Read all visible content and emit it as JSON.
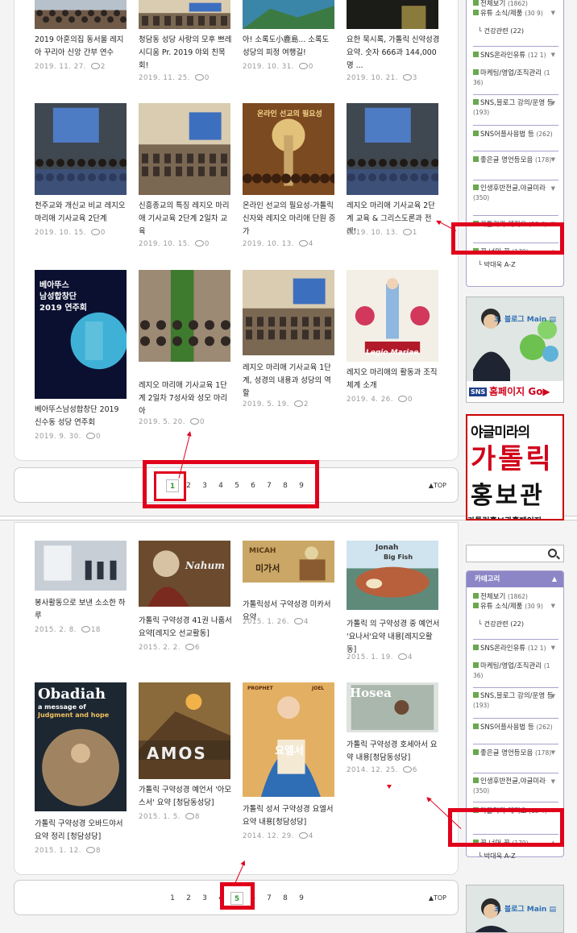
{
  "top": {
    "posts": [
      {
        "title": "2019 아훈의집 동서울 레지아 꾸리아 신앙 간부 연수",
        "date": "2019. 11. 27.",
        "comments": "2"
      },
      {
        "title": "청담동 성당 사랑의 모후 쁘레시디움 Pr. 2019 야외 친목회!",
        "date": "2019. 11. 25.",
        "comments": "0"
      },
      {
        "title": "아! 소록도小鹿島... 소록도 성당의 피정 여행길!",
        "date": "2019. 10. 31.",
        "comments": "0"
      },
      {
        "title": "요한 묵시록, 가톨릭 신약성경 요약. 숫자 666과 144,000명 ...",
        "date": "2019. 10. 21.",
        "comments": "3"
      },
      {
        "title": "천주교와 개신교 비교 레지오 마리애 기사교육 2단계",
        "date": "2019. 10. 15.",
        "comments": "0"
      },
      {
        "title": "신흥종교의 특징 레지오 마리애 기사교육 2단계 2일차 교육",
        "date": "2019. 10. 15.",
        "comments": "0"
      },
      {
        "title": "온라인 선교의 필요성-가톨릭 신자와 레지오 마리애 단원 증가",
        "date": "2019. 10. 13.",
        "comments": "4"
      },
      {
        "title": "레지오 마리애 기사교육 2단계 교육 & 그리스도론과 전례!",
        "date": "2019. 10. 13.",
        "comments": "1"
      },
      {
        "title": "베아뚜스남성합창단 2019 신수동 성당 연주회",
        "date": "2019. 9. 30.",
        "comments": "0"
      },
      {
        "title": "레지오 마리애 기사교육 1단계 2일차 7성사와 성모 마리아",
        "date": "2019. 5. 20.",
        "comments": "0"
      },
      {
        "title": "레지오 마리애 기사교육 1단계, 성경의 내용과 성당의 역할",
        "date": "2019. 5. 19.",
        "comments": "2"
      },
      {
        "title": "레지오 마리애의 활동과 조직체계 소개",
        "date": "2019. 4. 26.",
        "comments": "0"
      }
    ],
    "thumb_texts": {
      "p7": "온라인 선교의 필요성",
      "p9a": "베아뚜스",
      "p9b": "남성합창단",
      "p9c": "2019 연주회",
      "p12": "Legio Mariae"
    },
    "pages": [
      "1",
      "2",
      "3",
      "4",
      "5",
      "6",
      "7",
      "8",
      "9"
    ],
    "current_page": "1",
    "top_label": "▲TOP"
  },
  "bottom": {
    "posts": [
      {
        "title": "봉사활동으로 보낸 소소한 하루",
        "date": "2015. 2. 8.",
        "comments": "18"
      },
      {
        "title": "가톨릭 구약성경 41권 나훔서 요약[레지오 선교활동]",
        "date": "2015. 2. 2.",
        "comments": "6"
      },
      {
        "title": "가톨릭성서 구약성경 미카서 요약",
        "date": "2015. 1. 26.",
        "comments": "4"
      },
      {
        "title": "가톨릭 의 구약성경 중 예언서 '요나서'요약 내용[레지오활동]",
        "date": "2015. 1. 19.",
        "comments": "4"
      },
      {
        "title": "가톨릭 구약성경 오바드야서 요약 정리 [청담성당]",
        "date": "2015. 1. 12.",
        "comments": "8"
      },
      {
        "title": "가톨릭 구약성경 예언서 '아모스서' 요약 [청담동성당]",
        "date": "2015. 1. 5.",
        "comments": "8"
      },
      {
        "title": "가톨릭 성서 구약성경 요엘서 요약 내용[청담성당]",
        "date": "2014. 12. 29.",
        "comments": "4"
      },
      {
        "title": "가톨릭 구약성경 호세아서 요약 내용[청담동성당]",
        "date": "2014. 12. 25.",
        "comments": "6"
      }
    ],
    "thumb_texts": {
      "p2": "Nahum",
      "p3a": "MICAH",
      "p3b": "미가서",
      "p4a": "Jonah",
      "p4b": "Big Fish",
      "p5a": "Obadiah",
      "p5b": "a message of",
      "p5c": "Judgment and hope",
      "p6": "AMOS",
      "p7a": "PROPHET",
      "p7b": "JOEL",
      "p7c": "요엘서",
      "p8": "Hosea"
    },
    "pages": [
      "1",
      "2",
      "3",
      "4",
      "5",
      "6",
      "7",
      "8",
      "9"
    ],
    "current_page": "5",
    "top_label": "▲TOP"
  },
  "sidebar": {
    "cat_header": "카테고리",
    "items": [
      {
        "label": "전체보기",
        "count": "(1862)"
      },
      {
        "label": "유튜 소식/제품",
        "count": "(30 9)"
      },
      {
        "label": "건강관련",
        "count": "(22)"
      },
      {
        "label": "SNS온라인유튜",
        "count": "(12 1)"
      },
      {
        "label": "마케팅/영업/조직관리",
        "count": "(1 36)"
      },
      {
        "label": "SNS,블로그 강의/운영 등",
        "count": "(193)"
      },
      {
        "label": "SNS어플사용법 등",
        "count": "(262)"
      },
      {
        "label": "좋은글 명언등모음",
        "count": "(178)"
      },
      {
        "label": "인생후반전글,야글미라",
        "count": "(350)"
      },
      {
        "label": "가톨릭과 레지오",
        "count": "(13 4)"
      },
      {
        "label": "꿈 너머 꿈",
        "count": "(179)"
      },
      {
        "label": "박대욱 A-Z",
        "count": ""
      }
    ],
    "banner1": {
      "title": "3. 블로그 Main ▤",
      "sns": "SNS",
      "homepage": "홈페이지 Go▶"
    },
    "banner2": {
      "line1": "야글미라의",
      "line2": "가톨릭",
      "line3": "홍보관",
      "line4": "가톨릭홍보관홈페이지"
    }
  },
  "colors": {
    "accent": "#e0001b",
    "catheader": "#8d86c6",
    "pagecurrent": "#3a9b3a"
  }
}
